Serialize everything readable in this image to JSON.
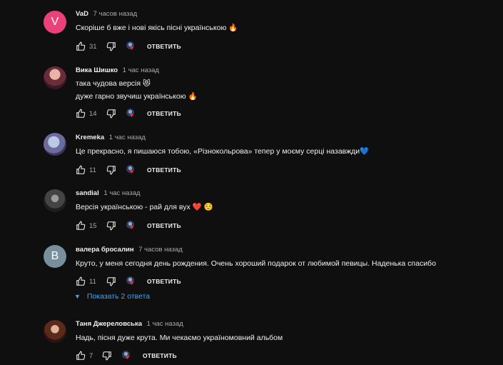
{
  "labels": {
    "reply": "ОТВЕТИТЬ",
    "show_replies": "Показать 2 ответа"
  },
  "icons": {
    "like": "thumb-up-icon",
    "dislike": "thumb-down-icon",
    "creator_heart": "creator-heart-icon",
    "expand": "chevron-down-icon"
  },
  "comments": [
    {
      "author": "VaD",
      "time": "7 часов назад",
      "avatar_letter": "V",
      "avatar_color": "#ec407a",
      "lines": [
        "Скоріше б вже і нові якісь пісні українською 🔥"
      ],
      "likes": "31"
    },
    {
      "author": "Вика Шишко",
      "time": "1 час назад",
      "lines": [
        "така чудова версія 😻",
        "дуже гарно звучиш українською 🔥"
      ],
      "likes": "14"
    },
    {
      "author": "Kremeka",
      "time": "1 час назад",
      "lines": [
        "Це прекрасно, я пишаюся тобою, «Різнокольрова» тепер у моєму серці назавжди💙"
      ],
      "likes": "11"
    },
    {
      "author": "sandial",
      "time": "1 час назад",
      "lines": [
        "Версія українською - рай для вух ❤️ ☺️"
      ],
      "likes": "15"
    },
    {
      "author": "валера бросалин",
      "time": "7 часов назад",
      "avatar_letter": "B",
      "avatar_color": "#78909c",
      "lines": [
        "Круто, у меня сегодня день рождения. Очень хороший подарок от любимой певицы. Наденька спасибо"
      ],
      "likes": "11"
    },
    {
      "author": "Таня Джереловська",
      "time": "1 час назад",
      "lines": [
        "Надь, пісня дуже крута. Ми чекаємо україномовний альбом"
      ],
      "likes": "7"
    }
  ]
}
